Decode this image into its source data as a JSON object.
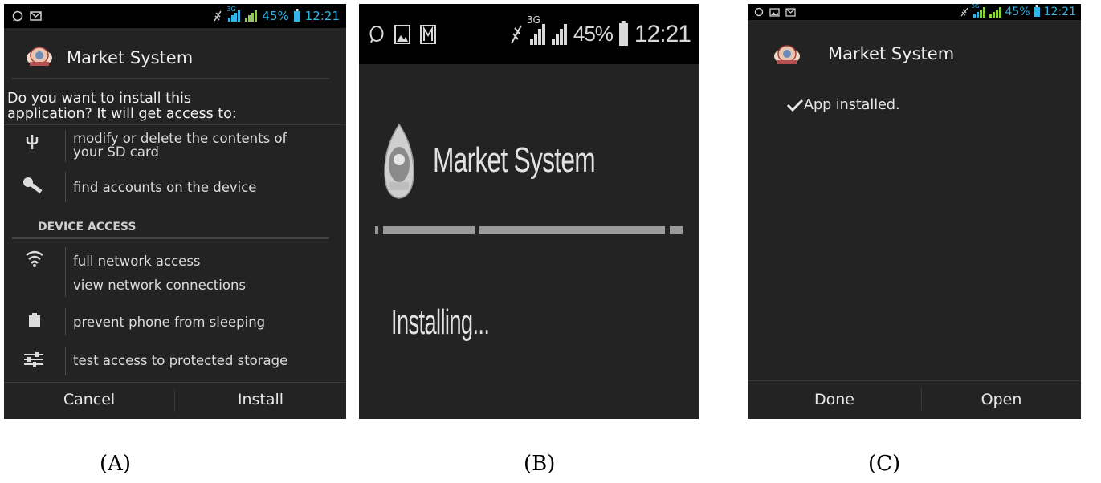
{
  "screens": {
    "a": {
      "status": {
        "battery": "45%",
        "time": "12:21",
        "network": "3G"
      },
      "app_name": "Market System",
      "question": [
        "Do you want to install this",
        "application? It will get access to:"
      ],
      "permissions": {
        "sd_card": [
          "modify or delete the contents of",
          "your SD card"
        ],
        "accounts": "find accounts on the device",
        "section_header": "DEVICE ACCESS",
        "network_full": "full network access",
        "network_view": "view network connections",
        "sleep": "prevent phone from sleeping",
        "storage": "test access to protected storage"
      },
      "buttons": {
        "cancel": "Cancel",
        "install": "Install"
      }
    },
    "b": {
      "status": {
        "battery": "45%",
        "time": "12:21",
        "network": "3G"
      },
      "app_name": "Market System",
      "installing": "Installing..."
    },
    "c": {
      "status": {
        "battery": "45%",
        "time": "12:21",
        "network": "3G"
      },
      "app_name": "Market System",
      "message": "App installed.",
      "buttons": {
        "done": "Done",
        "open": "Open"
      }
    }
  },
  "captions": {
    "a": "(A)",
    "b": "(B)",
    "c": "(C)"
  },
  "colors": {
    "screen_bg": "#232323",
    "status_bg": "#000000",
    "accent_blue": "#33b5e5",
    "signal_green": "#8fd13f"
  }
}
